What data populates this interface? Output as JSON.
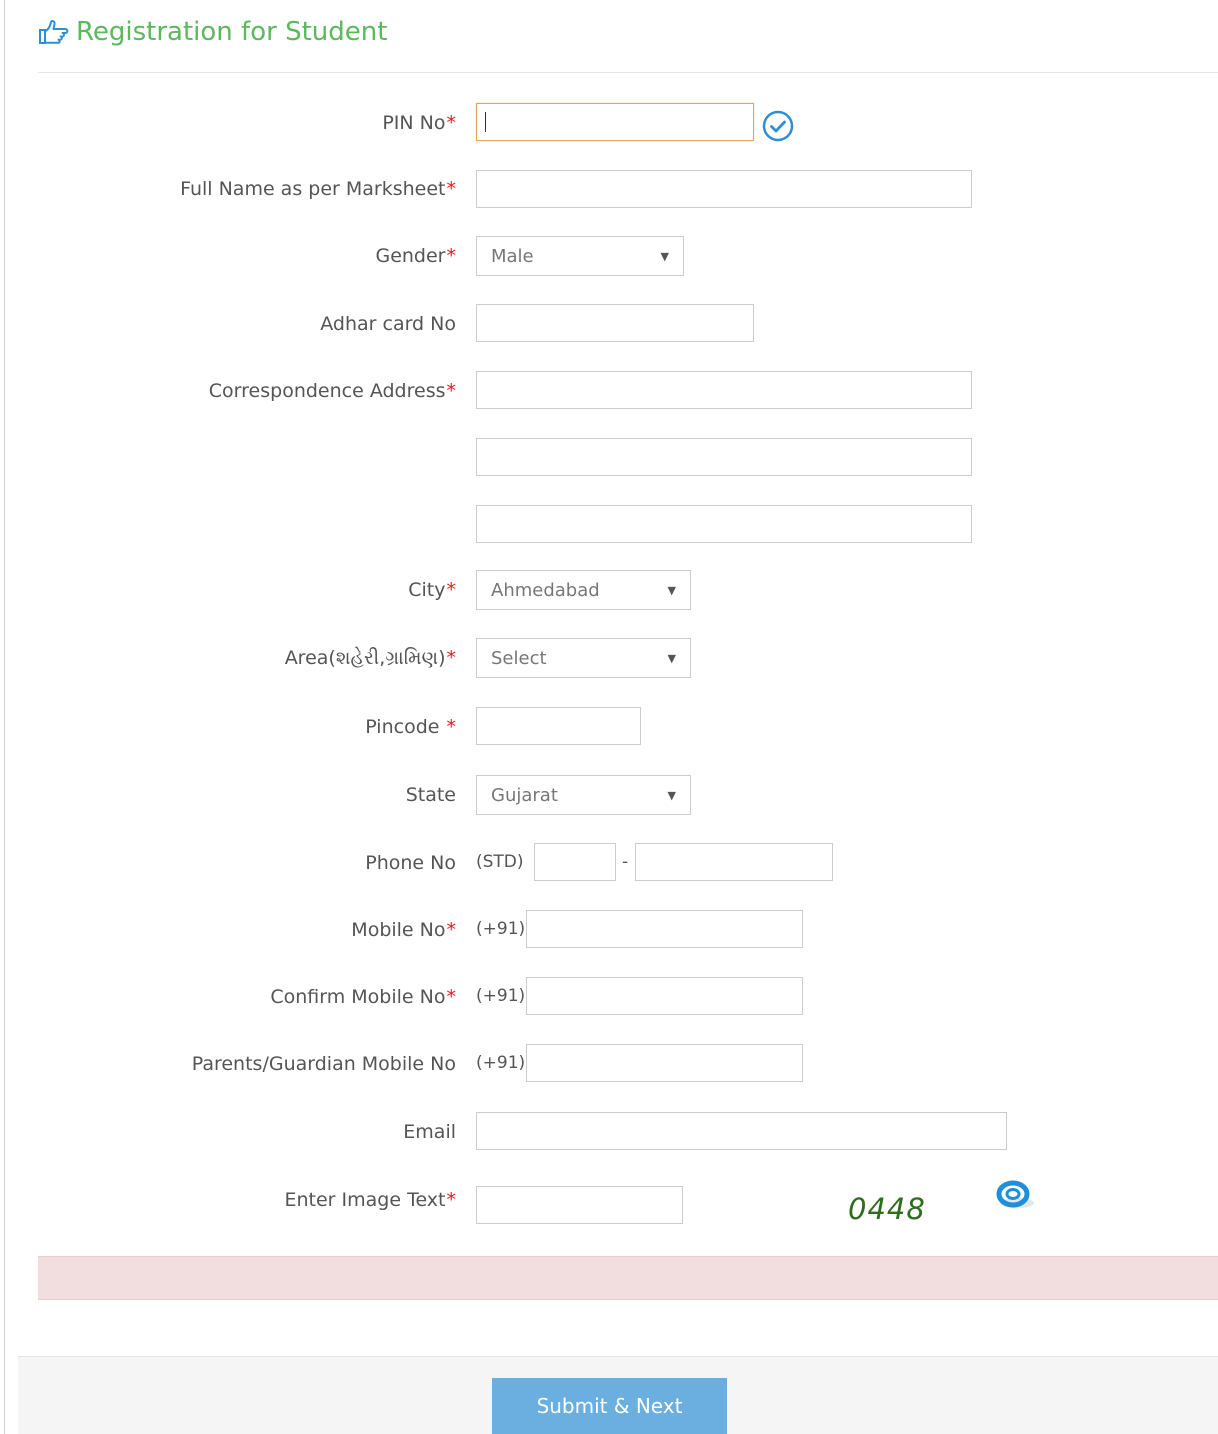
{
  "header": {
    "title": "Registration for Student"
  },
  "form": {
    "pin": {
      "label": "PIN No",
      "req": "*",
      "value": ""
    },
    "full_name": {
      "label": "Full Name as per Marksheet",
      "req": "*",
      "value": ""
    },
    "gender": {
      "label": "Gender",
      "req": "*",
      "selected": "Male"
    },
    "adhar": {
      "label": "Adhar card No",
      "value": ""
    },
    "address": {
      "label": "Correspondence Address",
      "req": "*",
      "line1": "",
      "line2": "",
      "line3": ""
    },
    "city": {
      "label": "City",
      "req": "*",
      "selected": "Ahmedabad"
    },
    "area": {
      "label": "Area(શહેરી,ગ્રામિણ)",
      "req": "*",
      "selected": "Select"
    },
    "pincode": {
      "label": "Pincode ",
      "req": "*",
      "value": ""
    },
    "state": {
      "label": "State",
      "selected": "Gujarat"
    },
    "phone": {
      "label": "Phone No",
      "std_prefix": "(STD)",
      "separator": "-",
      "std": "",
      "number": ""
    },
    "mobile": {
      "label": "Mobile No",
      "req": "*",
      "prefix": "(+91)",
      "value": ""
    },
    "confirm_mobile": {
      "label": "Confirm Mobile No",
      "req": "*",
      "prefix": "(+91)",
      "value": ""
    },
    "parent_mobile": {
      "label": "Parents/Guardian Mobile No",
      "prefix": "(+91)",
      "value": ""
    },
    "email": {
      "label": "Email",
      "value": ""
    },
    "captcha": {
      "label": "Enter Image Text",
      "req": "*",
      "image_text": "0448",
      "value": ""
    }
  },
  "actions": {
    "submit_label": "Submit & Next"
  },
  "icons": {
    "title": "hand-pointing-right-icon",
    "verify": "check-circle-icon",
    "refresh": "refresh-captcha-icon",
    "dropdown": "chevron-down-icon"
  },
  "colors": {
    "title": "#5cb85c",
    "required": "#e02020",
    "focus_border": "#e8a35a",
    "error_bar": "#f2dede",
    "submit_button": "#6aafdf",
    "captcha_text": "#2d6d1c",
    "verify_icon": "#2f8fd6"
  }
}
